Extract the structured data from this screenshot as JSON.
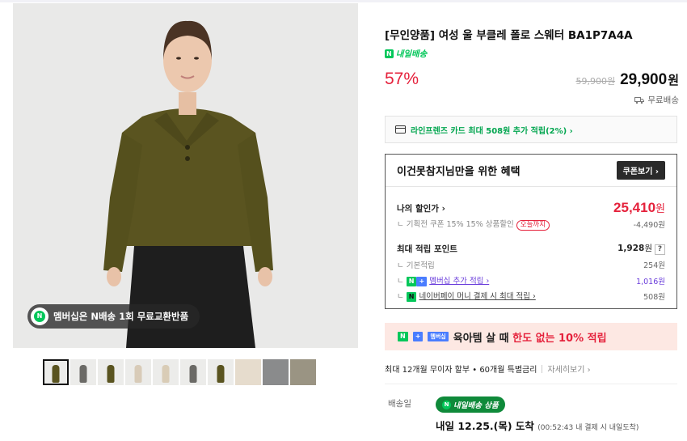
{
  "product": {
    "title": "[무인양품] 여성 울 부클레 폴로 스웨터 BA1P7A4A",
    "delivery_badge_icon": "N",
    "delivery_badge_text": "내일배송",
    "discount": "57%",
    "original_price": "59,900원",
    "price": "29,900",
    "price_unit": "원",
    "shipping": "무료배송"
  },
  "image": {
    "promo_icon": "N",
    "promo_text": "멤버십은 N배송 1회 무료교환반품",
    "thumbnail_count": 10,
    "selected_thumbnail": 0
  },
  "card_offer": {
    "text": "라인프렌즈 카드 최대 508원 추가 적립(2%) ›"
  },
  "benefits": {
    "title": "이건못참지님만을 위한 혜택",
    "coupon_button": "쿠폰보기 ›",
    "my_price_label": "나의 할인가 ›",
    "my_price": "25,410",
    "my_price_unit": "원",
    "coupon_desc": "기획전 쿠폰 15% 15% 상품할인",
    "coupon_tag": "오늘까지",
    "coupon_amount": "-4,490원",
    "points_label": "최대 적립 포인트",
    "points_total": "1,928",
    "points_unit": "원",
    "points_help": "?",
    "base_label": "기본적립",
    "base_amount": "254원",
    "membership_badge_n": "N",
    "membership_badge_plus": "+",
    "membership_link": "멤버십 추가 적립 ›",
    "membership_amount": "1,016원",
    "pay_badge": "N",
    "pay_link": "네이버페이 머니 결제 시 최대 적립 ›",
    "pay_amount": "508원"
  },
  "promo": {
    "badge_n": "N",
    "badge_plus": "+",
    "badge_membership": "멤버십",
    "text_before": "육아템 살 때 ",
    "highlight": "한도 없는 10% 적립"
  },
  "installment": {
    "text": "최대 12개월 무이자 할부 • 60개월 특별금리",
    "more": "자세히보기 ›"
  },
  "delivery": {
    "label": "배송일",
    "pill_icon": "N",
    "pill_text": "내일배송 상품",
    "arrival_main": "내일 12.25.(목) 도착",
    "arrival_note": "(00:52:43 내 결제 시 내일도착)"
  },
  "colors": {
    "accent_red": "#e5223c",
    "naver_green": "#03c75a",
    "sweater": "#5a5420"
  }
}
